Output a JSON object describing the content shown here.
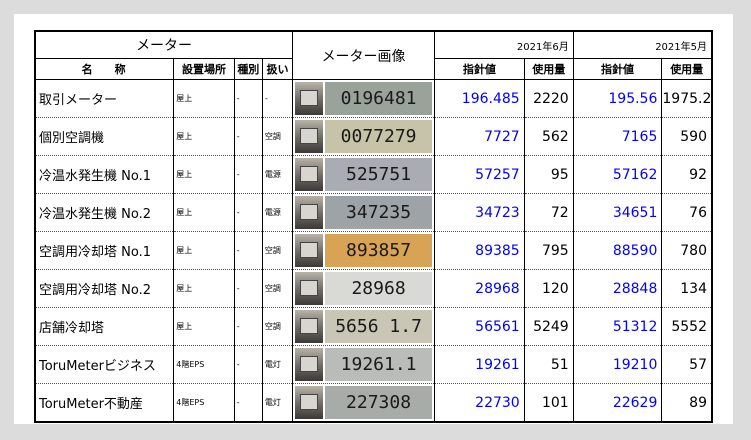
{
  "header": {
    "meter_group": "メーター",
    "image_col": "メーター画像",
    "month_current": "2021年6月",
    "month_previous": "2021年5月",
    "col_name": "名称",
    "col_location": "設置場所",
    "col_type": "種別",
    "col_handling": "扱い",
    "col_reading": "指針値",
    "col_usage": "使用量"
  },
  "rows": [
    {
      "name": "取引メーター",
      "location": "屋上",
      "type": "-",
      "handling": "-",
      "display": "0196481",
      "display_bg": "#9aa39a",
      "cur_reading": "196.485",
      "cur_usage": "2220",
      "prev_reading": "195.56",
      "prev_usage": "1975.2"
    },
    {
      "name": "個別空調機",
      "location": "屋上",
      "type": "-",
      "handling": "空調",
      "display": "0077279",
      "display_bg": "#c7c3a8",
      "cur_reading": "7727",
      "cur_usage": "562",
      "prev_reading": "7165",
      "prev_usage": "590"
    },
    {
      "name": "冷温水発生機 No.1",
      "location": "屋上",
      "type": "-",
      "handling": "電源",
      "display": "525751",
      "display_bg": "#a9adb3",
      "cur_reading": "57257",
      "cur_usage": "95",
      "prev_reading": "57162",
      "prev_usage": "92"
    },
    {
      "name": "冷温水発生機 No.2",
      "location": "屋上",
      "type": "-",
      "handling": "電源",
      "display": "347235",
      "display_bg": "#9ea3a8",
      "cur_reading": "34723",
      "cur_usage": "72",
      "prev_reading": "34651",
      "prev_usage": "76"
    },
    {
      "name": "空調用冷却塔 No.1",
      "location": "屋上",
      "type": "-",
      "handling": "空調",
      "display": "893857",
      "display_bg": "#d8a354",
      "cur_reading": "89385",
      "cur_usage": "795",
      "prev_reading": "88590",
      "prev_usage": "780"
    },
    {
      "name": "空調用冷却塔 No.2",
      "location": "屋上",
      "type": "-",
      "handling": "空調",
      "display": "28968",
      "display_bg": "#d9d9d6",
      "cur_reading": "28968",
      "cur_usage": "120",
      "prev_reading": "28848",
      "prev_usage": "134"
    },
    {
      "name": "店舗冷却塔",
      "location": "屋上",
      "type": "-",
      "handling": "空調",
      "display": "5656 1.7",
      "display_bg": "#c9c6b6",
      "cur_reading": "56561",
      "cur_usage": "5249",
      "prev_reading": "51312",
      "prev_usage": "5552"
    },
    {
      "name": "ToruMeterビジネス",
      "location": "4階EPS",
      "type": "-",
      "handling": "電灯",
      "display": "19261.1",
      "display_bg": "#b9bcb9",
      "cur_reading": "19261",
      "cur_usage": "51",
      "prev_reading": "19210",
      "prev_usage": "57"
    },
    {
      "name": "ToruMeter不動産",
      "location": "4階EPS",
      "type": "-",
      "handling": "電灯",
      "display": "227308",
      "display_bg": "#a8aca9",
      "cur_reading": "22730",
      "cur_usage": "101",
      "prev_reading": "22629",
      "prev_usage": "89"
    }
  ]
}
